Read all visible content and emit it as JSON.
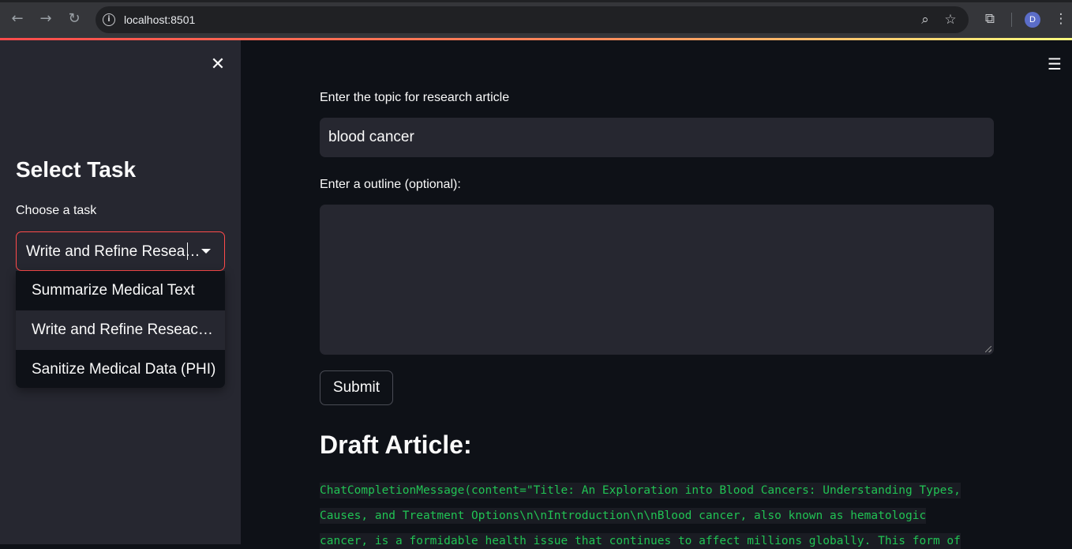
{
  "browser": {
    "url": "localhost:8501",
    "avatar_initial": "D"
  },
  "sidebar": {
    "title": "Select Task",
    "select_label": "Choose a task",
    "selected_value": "Write and Refine Resea…",
    "options": [
      "Summarize Medical Text",
      "Write and Refine Reseac…",
      "Sanitize Medical Data (PHI)"
    ]
  },
  "main": {
    "topic_label": "Enter the topic for research article",
    "topic_value": "blood cancer",
    "outline_label": "Enter a outline (optional):",
    "outline_value": "",
    "submit_label": "Submit",
    "draft_heading": "Draft Article:",
    "draft_lines": [
      " ChatCompletionMessage(content=\"Title: An Exploration into Blood Cancers: Understanding Types,",
      "Causes, and Treatment Options\\n\\nIntroduction\\n\\nBlood cancer, also known as hematologic",
      "cancer, is a formidable health issue that continues to affect millions globally. This form of"
    ]
  },
  "colors": {
    "accent": "#ff4b4b",
    "code_text": "#21c354",
    "background": "#0e1117",
    "sidebar": "#262730"
  }
}
